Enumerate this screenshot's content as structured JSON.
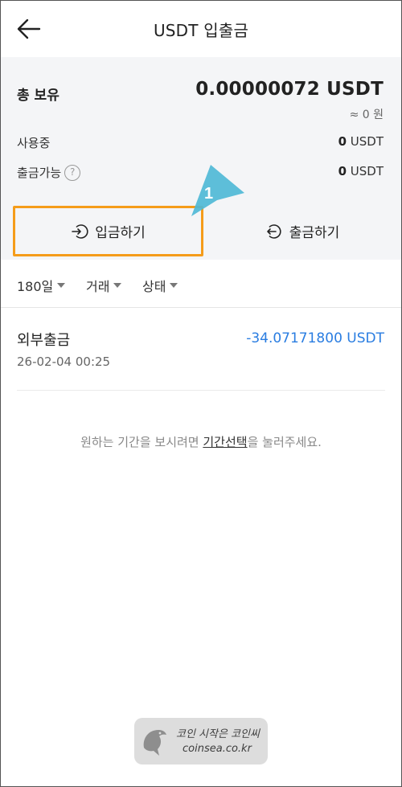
{
  "header": {
    "title": "USDT 입출금"
  },
  "summary": {
    "total_label": "총 보유",
    "total_value": "0.00000072 USDT",
    "approx_value": "≈ 0 원",
    "in_use_label": "사용중",
    "in_use_amount": "0",
    "in_use_unit": " USDT",
    "withdrawable_label": "출금가능",
    "withdrawable_amount": "0",
    "withdrawable_unit": " USDT"
  },
  "actions": {
    "deposit_label": "입금하기",
    "withdraw_label": "출금하기"
  },
  "callout": {
    "number": "1"
  },
  "filters": {
    "period": "180일",
    "type": "거래",
    "status": "상태"
  },
  "transactions": [
    {
      "type": "외부출금",
      "datetime": "26-02-04 00:25",
      "amount": "-34.07171800 USDT"
    }
  ],
  "notice": {
    "before": "원하는 기간을 보시려면 ",
    "link": "기간선택",
    "after": "을 눌러주세요."
  },
  "watermark": {
    "line1": "코인 시작은 코인씨",
    "line2": "coinsea.co.kr"
  },
  "colors": {
    "highlight": "#f59c1a",
    "callout": "#4fb8d6",
    "amount": "#2a7de1",
    "summary_bg": "#f4f5f7"
  }
}
